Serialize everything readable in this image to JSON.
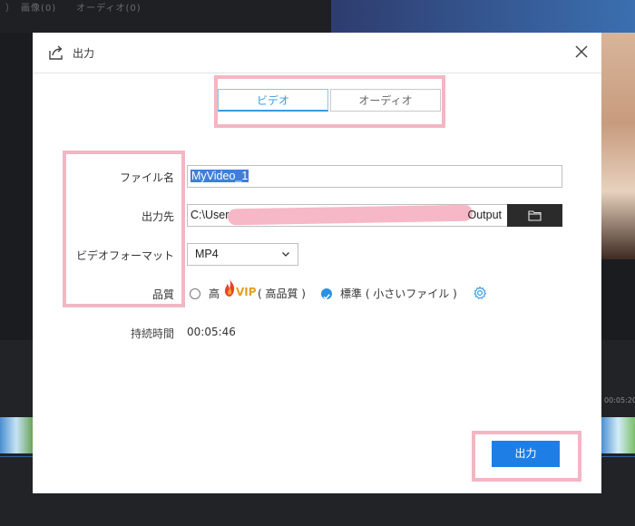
{
  "background": {
    "tab_text": "）　画像(0)　　オーディオ(0)",
    "timeline_time": "00:05:20"
  },
  "dialog": {
    "title": "出力",
    "tabs": [
      {
        "label": "ビデオ",
        "active": true
      },
      {
        "label": "オーディオ",
        "active": false
      }
    ],
    "fields": {
      "file_name_label": "ファイル名",
      "file_name_value": "MyVideo_1",
      "output_path_label": "出力先",
      "output_path_start": "C:\\User",
      "output_path_end": "Output",
      "format_label": "ビデオフォーマット",
      "format_value": "MP4",
      "quality_label": "品質",
      "quality_high": "高",
      "vip_badge": "VIP",
      "quality_high_desc": "( 高品質 )",
      "quality_standard": "標準 ( 小さいファイル )",
      "duration_label": "持続時間",
      "duration_value": "00:05:46"
    },
    "export_button": "出力"
  },
  "colors": {
    "accent": "#1f7ee6",
    "highlight": "#f3b6c3",
    "vip": "#e2a11f"
  },
  "icons": [
    "export-icon",
    "close-icon",
    "folder-icon",
    "chevron-down-icon",
    "flame-icon",
    "settings-gear-icon",
    "checkmark-icon"
  ]
}
